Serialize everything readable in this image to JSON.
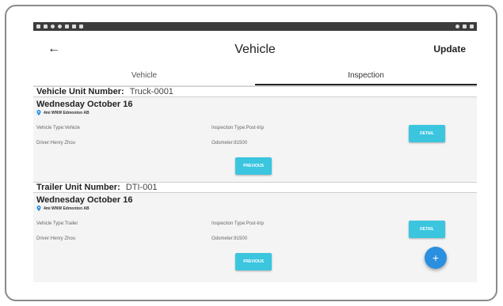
{
  "app": {
    "title": "Vehicle",
    "update_label": "Update",
    "back_icon": "arrow-left-icon",
    "accent_color": "#3bc5df",
    "fab_color": "#2b8fe0"
  },
  "tabs": [
    {
      "label": "Vehicle",
      "active": true
    },
    {
      "label": "Inspection",
      "active": false
    }
  ],
  "vehicle_section": {
    "unit_label": "Vehicle Unit Number:",
    "unit_value": "Truck-0001",
    "date": "Wednesday October 16",
    "location": "4mi WNW Edmonton AB",
    "vehicle_type": "Vehicle Type:Vehicle",
    "inspection_type": "Inspection Type:Post-trip",
    "driver": "Driver:Henry Zhou",
    "odometer": "Odometer:81500",
    "detail_label": "DETAIL",
    "previous_label": "PREVIOUS"
  },
  "trailer_section": {
    "unit_label": "Trailer Unit Number:",
    "unit_value": "DTI-001",
    "date": "Wednesday October 16",
    "location": "4mi WNW Edmonton AB",
    "vehicle_type": "Vehicle Type:Trailer",
    "inspection_type": "Inspection Type:Post-trip",
    "driver": "Driver:Henry Zhou",
    "odometer": "Odometer:81500",
    "detail_label": "DETAIL",
    "previous_label": "PREVIOUS"
  },
  "fab": {
    "label": "+",
    "icon": "plus-icon"
  }
}
